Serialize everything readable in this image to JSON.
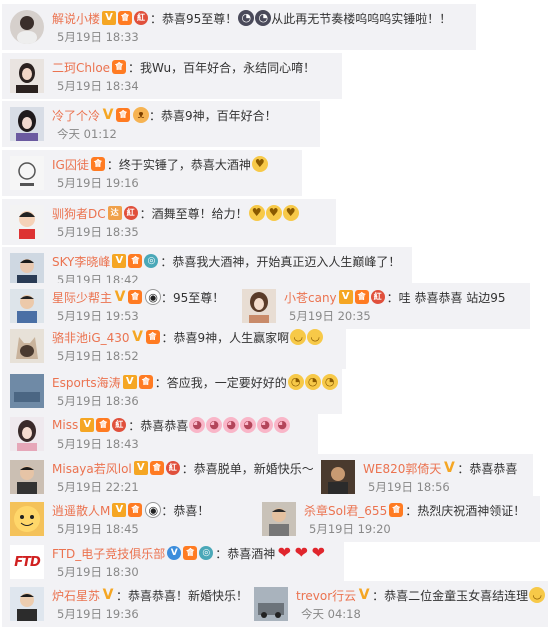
{
  "comments": [
    {
      "name": "解说小楼",
      "text": "：恭喜95至尊！",
      "text2": "从此再无节奏楼呜呜呜实锤啦！！",
      "time": "5月19日 18:33"
    },
    {
      "name": "二珂Chloe",
      "text": "：我Wu，百年好合，永结同心唷！",
      "time": "5月19日 18:34"
    },
    {
      "name": "冷了个冷",
      "text": "：恭喜9神，百年好合！",
      "time": "今天 01:12"
    },
    {
      "name": "IG囚徒",
      "text": "：终于实锤了，恭喜大酒神",
      "time": "5月19日 19:16"
    },
    {
      "name": "驯狗者DC",
      "text": "：酒舞至尊！给力！",
      "time": "5月19日 18:35"
    },
    {
      "name": "SKY李晓峰",
      "text": "：恭喜我大酒神，开始真正迈入人生巅峰了！",
      "time": "5月19日 18:42"
    },
    {
      "name": "星际少帮主",
      "text": "：95至尊！",
      "time": "5月19日 19:53"
    },
    {
      "name": "小苍cany",
      "text": "：哇 恭喜恭喜 站边95",
      "time": "5月19日 20:35"
    },
    {
      "name": "骆非池iG_430",
      "text": "：恭喜9神，人生赢家啊",
      "time": "5月19日 18:52"
    },
    {
      "name": "Esports海涛",
      "text": "：答应我，一定要好好的",
      "time": "5月19日 18:36"
    },
    {
      "name": "Miss",
      "text": "：恭喜恭喜",
      "time": "5月19日 18:43"
    },
    {
      "name": "Misaya若风lol",
      "text": "：恭喜脱单，新婚快乐～",
      "time": "5月19日 22:21"
    },
    {
      "name": "WE820郭倚天",
      "text": "：恭喜恭喜",
      "time": "5月19日 18:56"
    },
    {
      "name": "逍遥散人M",
      "text": "：恭喜！",
      "time": "5月19日 18:45"
    },
    {
      "name": "杀章Sol君_655",
      "text": "：热烈庆祝酒神领证！",
      "time": "5月19日 19:20"
    },
    {
      "name": "FTD_电子竞技俱乐部",
      "text": "：恭喜酒神",
      "time": "5月19日 18:30"
    },
    {
      "name": "炉石星苏",
      "text": "：恭喜恭喜！新婚快乐！",
      "time": "5月19日 19:36"
    },
    {
      "name": "trevor行云",
      "text": "：恭喜二位金童玉女喜结连理",
      "time": "今天 04:18"
    }
  ],
  "badges": {
    "v": "V",
    "vip": "會",
    "red": "紅",
    "cam": "◎",
    "tr": "达"
  },
  "emoji": {
    "hug": "♥",
    "cry": "◔",
    "smile": "◡",
    "pig": "◕",
    "heart": "❤",
    "panda": "◉",
    "cat": "ᴥ",
    "laugh": "◡"
  },
  "ftd_logo": "FTD",
  "colors": {
    "name": "#eb7350",
    "bg": "#f2f2f5",
    "time": "#888888"
  }
}
